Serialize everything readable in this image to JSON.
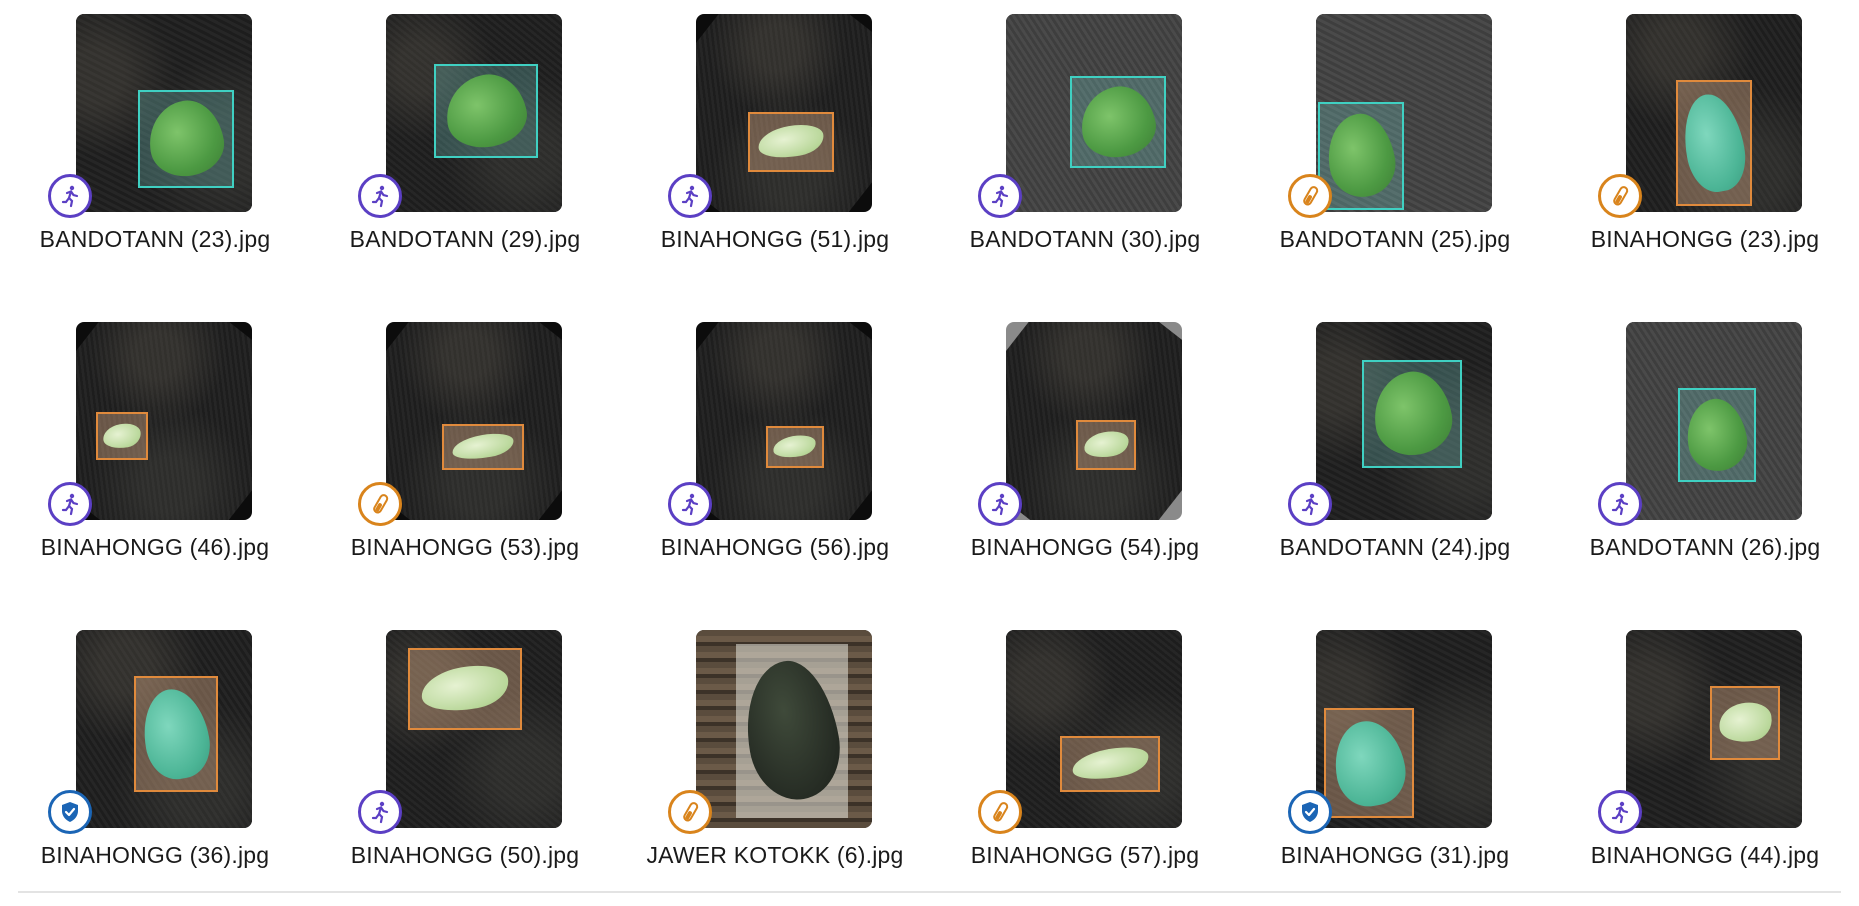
{
  "files": [
    {
      "name": "BANDOTANN (23).jpg",
      "split": "train"
    },
    {
      "name": "BANDOTANN (29).jpg",
      "split": "train"
    },
    {
      "name": "BINAHONGG (51).jpg",
      "split": "train"
    },
    {
      "name": "BANDOTANN (30).jpg",
      "split": "train"
    },
    {
      "name": "BANDOTANN (25).jpg",
      "split": "test"
    },
    {
      "name": "BINAHONGG (23).jpg",
      "split": "test"
    },
    {
      "name": "BINAHONGG (46).jpg",
      "split": "train"
    },
    {
      "name": "BINAHONGG (53).jpg",
      "split": "test"
    },
    {
      "name": "BINAHONGG (56).jpg",
      "split": "train"
    },
    {
      "name": "BINAHONGG (54).jpg",
      "split": "train"
    },
    {
      "name": "BANDOTANN (24).jpg",
      "split": "train"
    },
    {
      "name": "BANDOTANN (26).jpg",
      "split": "train"
    },
    {
      "name": "BINAHONGG (36).jpg",
      "split": "valid"
    },
    {
      "name": "BINAHONGG (50).jpg",
      "split": "train"
    },
    {
      "name": "JAWER KOTOKK (6).jpg",
      "split": "test"
    },
    {
      "name": "BINAHONGG (57).jpg",
      "split": "test"
    },
    {
      "name": "BINAHONGG (31).jpg",
      "split": "valid"
    },
    {
      "name": "BINAHONGG (44).jpg",
      "split": "train"
    }
  ],
  "badge_icons": {
    "train": "running-person-icon",
    "test": "test-tube-icon",
    "valid": "shield-check-icon"
  },
  "colors": {
    "train": "#5b3fc4",
    "test": "#d9841c",
    "valid": "#1b65b5",
    "bbox_orange": "#e08a3c",
    "bbox_teal": "#3fd0c2"
  }
}
